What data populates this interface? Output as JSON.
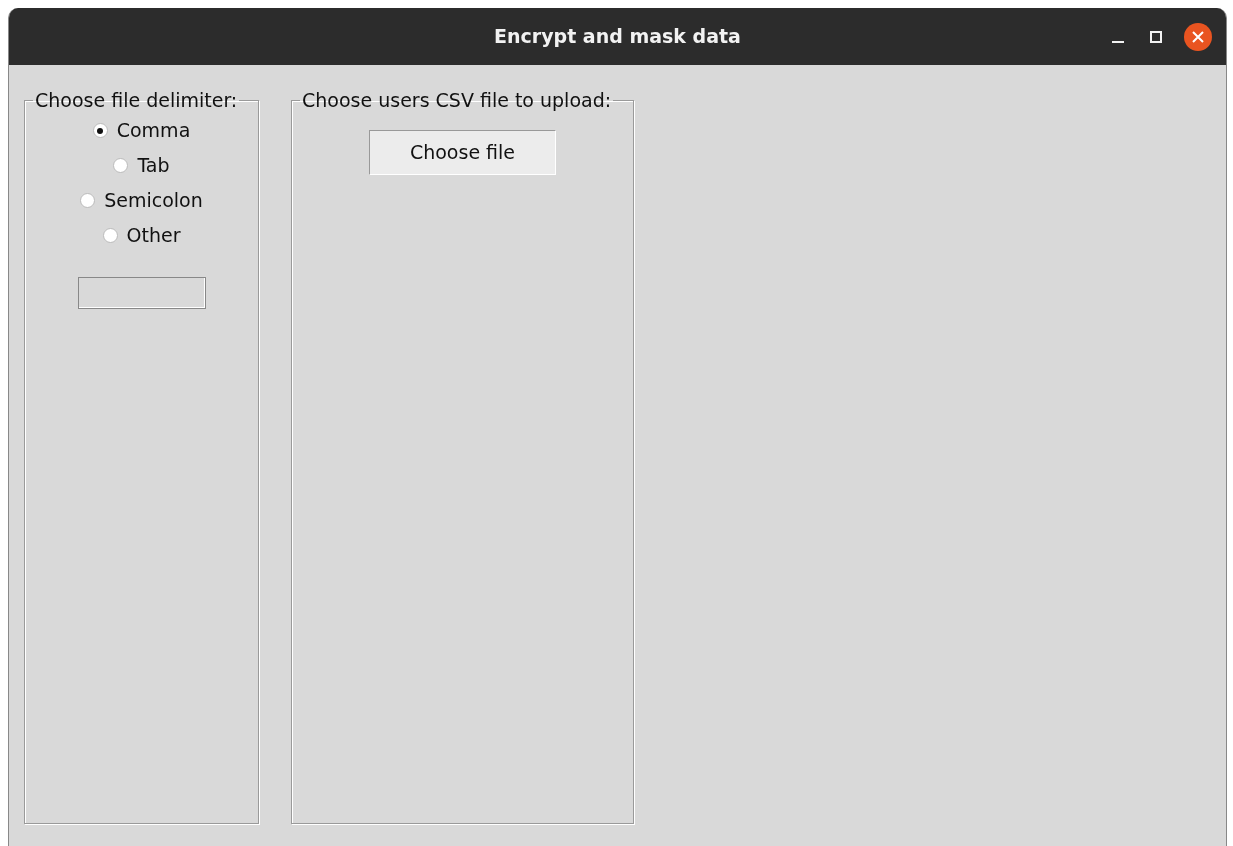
{
  "window": {
    "title": "Encrypt and mask data"
  },
  "delimiter_frame": {
    "label": "Choose file delimiter:",
    "options": [
      {
        "label": "Comma",
        "selected": true
      },
      {
        "label": "Tab",
        "selected": false
      },
      {
        "label": "Semicolon",
        "selected": false
      },
      {
        "label": "Other",
        "selected": false
      }
    ]
  },
  "upload_frame": {
    "label": "Choose users CSV file to upload:",
    "button": "Choose file"
  }
}
